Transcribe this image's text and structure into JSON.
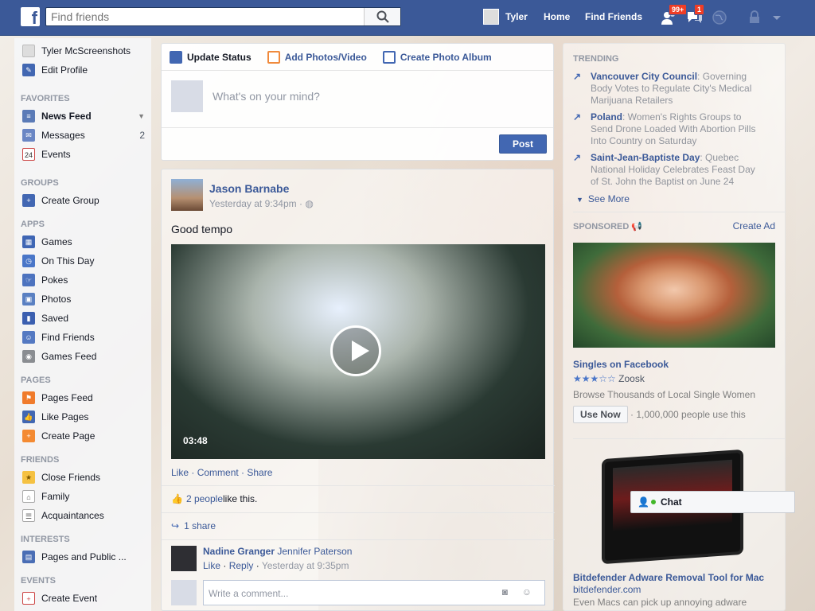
{
  "topbar": {
    "search_placeholder": "Find friends",
    "user_name": "Tyler",
    "home": "Home",
    "find_friends": "Find Friends",
    "friend_requests_badge": "99+",
    "messages_badge": "1"
  },
  "sidebar": {
    "profile_name": "Tyler McScreenshots",
    "edit_profile": "Edit Profile",
    "favorites_header": "FAVORITES",
    "favorites": [
      {
        "label": "News Feed"
      },
      {
        "label": "Messages",
        "count": "2"
      },
      {
        "label": "Events",
        "icon_text": "24"
      }
    ],
    "groups_header": "GROUPS",
    "groups": [
      {
        "label": "Create Group"
      }
    ],
    "apps_header": "APPS",
    "apps": [
      {
        "label": "Games"
      },
      {
        "label": "On This Day"
      },
      {
        "label": "Pokes"
      },
      {
        "label": "Photos"
      },
      {
        "label": "Saved"
      },
      {
        "label": "Find Friends"
      },
      {
        "label": "Games Feed"
      }
    ],
    "pages_header": "PAGES",
    "pages": [
      {
        "label": "Pages Feed"
      },
      {
        "label": "Like Pages"
      },
      {
        "label": "Create Page"
      }
    ],
    "friends_header": "FRIENDS",
    "friends": [
      {
        "label": "Close Friends"
      },
      {
        "label": "Family"
      },
      {
        "label": "Acquaintances"
      }
    ],
    "interests_header": "INTERESTS",
    "interests": [
      {
        "label": "Pages and Public ..."
      }
    ],
    "events_header": "EVENTS",
    "events": [
      {
        "label": "Create Event"
      }
    ]
  },
  "composer": {
    "tab_update": "Update Status",
    "tab_photos": "Add Photos/Video",
    "tab_album": "Create Photo Album",
    "placeholder": "What's on your mind?",
    "post_label": "Post"
  },
  "story": {
    "author": "Jason Barnabe",
    "time": "Yesterday at 9:34pm ·",
    "text": "Good tempo",
    "video_duration": "03:48",
    "actions": {
      "like": "Like",
      "comment": "Comment",
      "share": "Share",
      "sep": " · "
    },
    "likes_link": "2 people",
    "likes_text": " like this.",
    "shares": "1 share",
    "comment": {
      "author": "Nadine Granger",
      "text": " Jennifer Paterson",
      "like": "Like",
      "reply": "Reply",
      "time": "Yesterday at 9:35pm"
    },
    "write_comment_placeholder": "Write a comment..."
  },
  "trending": {
    "header": "TRENDING",
    "items": [
      {
        "topic": "Vancouver City Council",
        "desc": ": Governing Body Votes to Regulate City's Medical Marijuana Retailers"
      },
      {
        "topic": "Poland",
        "desc": ": Women's Rights Groups to Send Drone Loaded With Abortion Pills Into Country on Saturday"
      },
      {
        "topic": "Saint-Jean-Baptiste Day",
        "desc": ": Quebec National Holiday Celebrates Feast Day of St. John the Baptist on June 24"
      }
    ],
    "see_more": "See More"
  },
  "sponsored": {
    "header": "SPONSORED",
    "create_ad": "Create Ad",
    "ad1": {
      "title": "Singles on Facebook",
      "stars": "★★★☆☆",
      "brand": "Zoosk",
      "body": "Browse Thousands of Local Single Women",
      "cta": "Use Now",
      "social": "· 1,000,000 people use this"
    },
    "ad2": {
      "title": "Bitdefender Adware Removal Tool for Mac",
      "domain": "bitdefender.com",
      "body": "Even Macs can pick up annoying adware"
    }
  },
  "chat": {
    "label": "Chat"
  },
  "colors": {
    "brand": "#3b5998",
    "link": "#3b5998",
    "badge": "#f03d25"
  }
}
